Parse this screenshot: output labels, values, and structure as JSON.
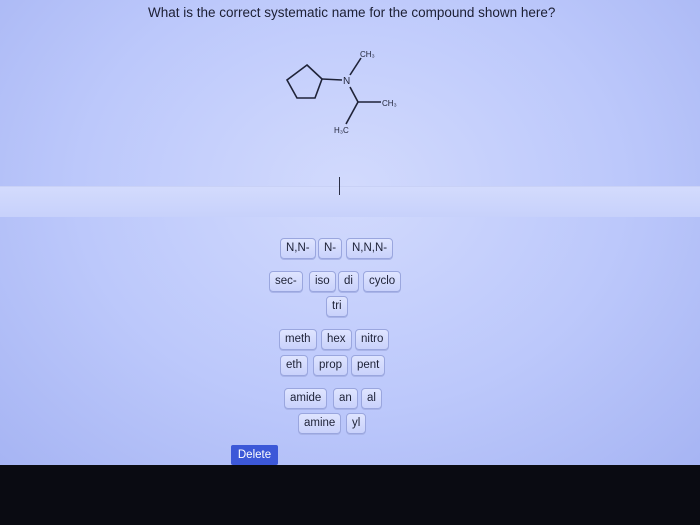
{
  "question": "What is the correct systematic name for the compound shown here?",
  "molecule": {
    "labels": {
      "n": "N",
      "ch3_top": "CH₃",
      "ch3_right": "CH₃",
      "h3c": "H₃C"
    }
  },
  "tiles": {
    "row1": [
      "N,N-",
      "N-",
      "N,N,N-"
    ],
    "row2": [
      "sec-",
      "iso",
      "di",
      "cyclo"
    ],
    "row3": [
      "tri"
    ],
    "row4": [
      "meth",
      "hex",
      "nitro"
    ],
    "row5": [
      "eth",
      "prop",
      "pent"
    ],
    "row6": [
      "amide",
      "an",
      "al"
    ],
    "row7": [
      "amine",
      "yl"
    ]
  },
  "delete_label": "Delete"
}
